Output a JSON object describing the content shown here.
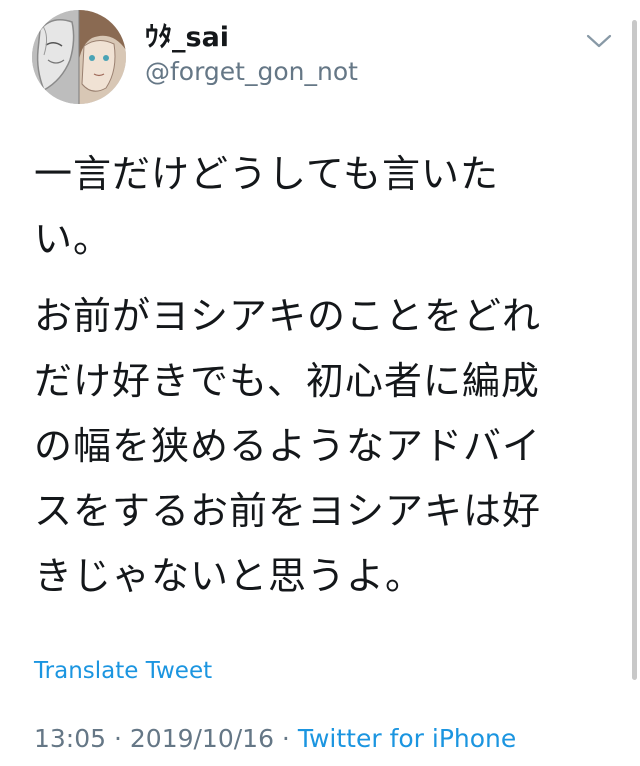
{
  "user": {
    "display_name": "ｳﾀ_sai",
    "handle": "@forget_gon_not",
    "avatar_icon": "avatar-icon"
  },
  "tweet": {
    "paragraph1_lines": [
      "一言だけどうしても言いた",
      "い。"
    ],
    "paragraph2_lines": [
      "お前がヨシアキのことをどれ",
      "だけ好きでも、初心者に編成",
      "の幅を狭めるようなアドバイ",
      "スをするお前をヨシアキは好",
      "きじゃないと思うよ。"
    ],
    "translate_label": "Translate Tweet",
    "time": "13:05",
    "separator": " · ",
    "date": "2019/10/16",
    "source": "Twitter for iPhone"
  },
  "colors": {
    "link": "#1b95e0",
    "secondary_text": "#657786",
    "primary_text": "#14171a"
  },
  "icons": {
    "caret": "chevron-down-icon"
  }
}
